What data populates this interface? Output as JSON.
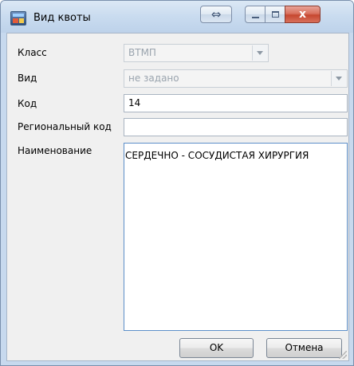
{
  "window": {
    "title": "Вид квоты",
    "icon": "app-icon"
  },
  "titlebar_buttons": {
    "expand_icon": "⇔",
    "close_icon": "x"
  },
  "form": {
    "class_label": "Класс",
    "class_value": "ВТМП",
    "kind_label": "Вид",
    "kind_value": "не задано",
    "code_label": "Код",
    "code_value": "14",
    "regional_code_label": "Региональный код",
    "regional_code_value": "",
    "name_label": "Наименование",
    "name_value": "СЕРДЕЧНО - СОСУДИСТАЯ ХИРУРГИЯ"
  },
  "buttons": {
    "ok": "OK",
    "cancel": "Отмена"
  }
}
